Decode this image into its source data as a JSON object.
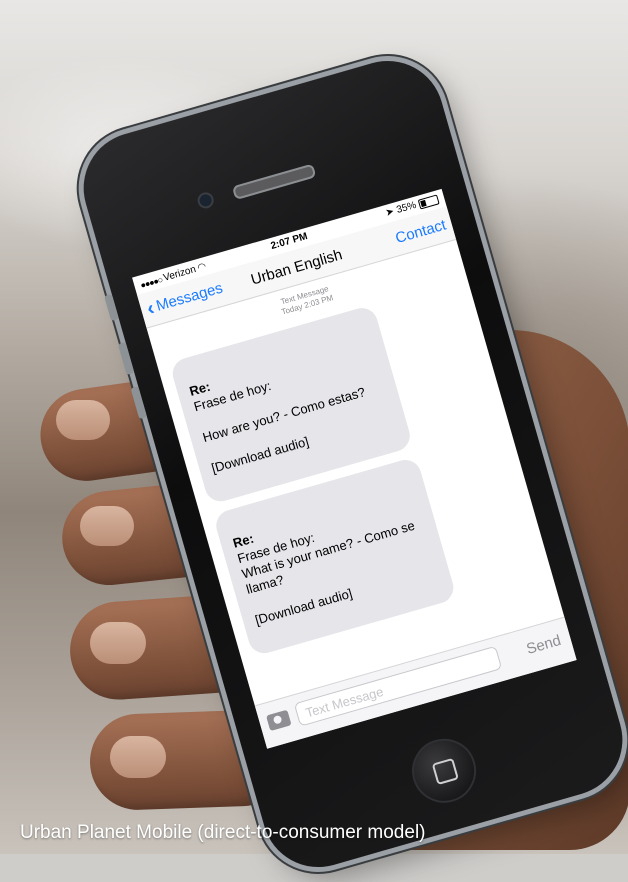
{
  "screen": {
    "status_bar": {
      "carrier": "Verizon",
      "time": "2:07 PM",
      "battery": "35%",
      "battery_level": 0.35
    },
    "nav": {
      "back_label": "Messages",
      "title": "Urban English",
      "contact_label": "Contact"
    },
    "thread_meta": {
      "line1": "Text Message",
      "line2": "Today 2:03 PM"
    },
    "messages": [
      {
        "heading": "Re:",
        "body": "Frase de hoy:\n\nHow are you? - Como estas?\n\n[Download audio]"
      },
      {
        "heading": "Re:",
        "body": "Frase de hoy:\nWhat is your name? - Como se llama?\n\n[Download audio]"
      }
    ],
    "composer": {
      "placeholder": "Text Message",
      "send_label": "Send",
      "camera_icon": "camera-icon"
    }
  },
  "caption": "Urban Planet Mobile (direct-to-consumer model)",
  "colors": {
    "accent": "#1a7bff",
    "bubble": "#e5e5ea"
  }
}
